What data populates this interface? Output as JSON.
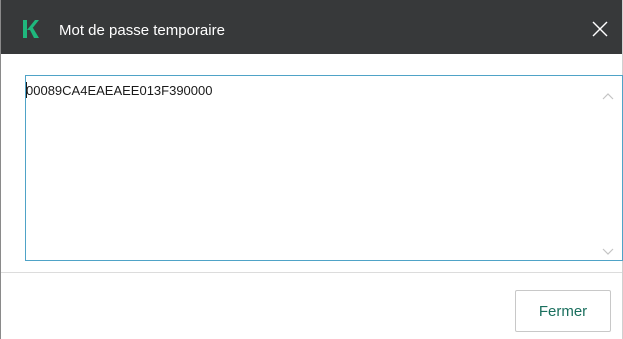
{
  "window": {
    "title": "Mot de passe temporaire",
    "app_icon": "kaspersky-k-icon",
    "close_icon": "close-icon",
    "accent_color": "#1fb77d",
    "titlebar_color": "#37393a"
  },
  "content": {
    "password_value": "00089CA4EAEAEE013F390000",
    "scroll_up_icon": "chevron-up-icon",
    "scroll_down_icon": "chevron-down-icon",
    "field_border_color": "#4fa3c7"
  },
  "footer": {
    "close_label": "Fermer",
    "close_label_color": "#1a6f5e"
  }
}
